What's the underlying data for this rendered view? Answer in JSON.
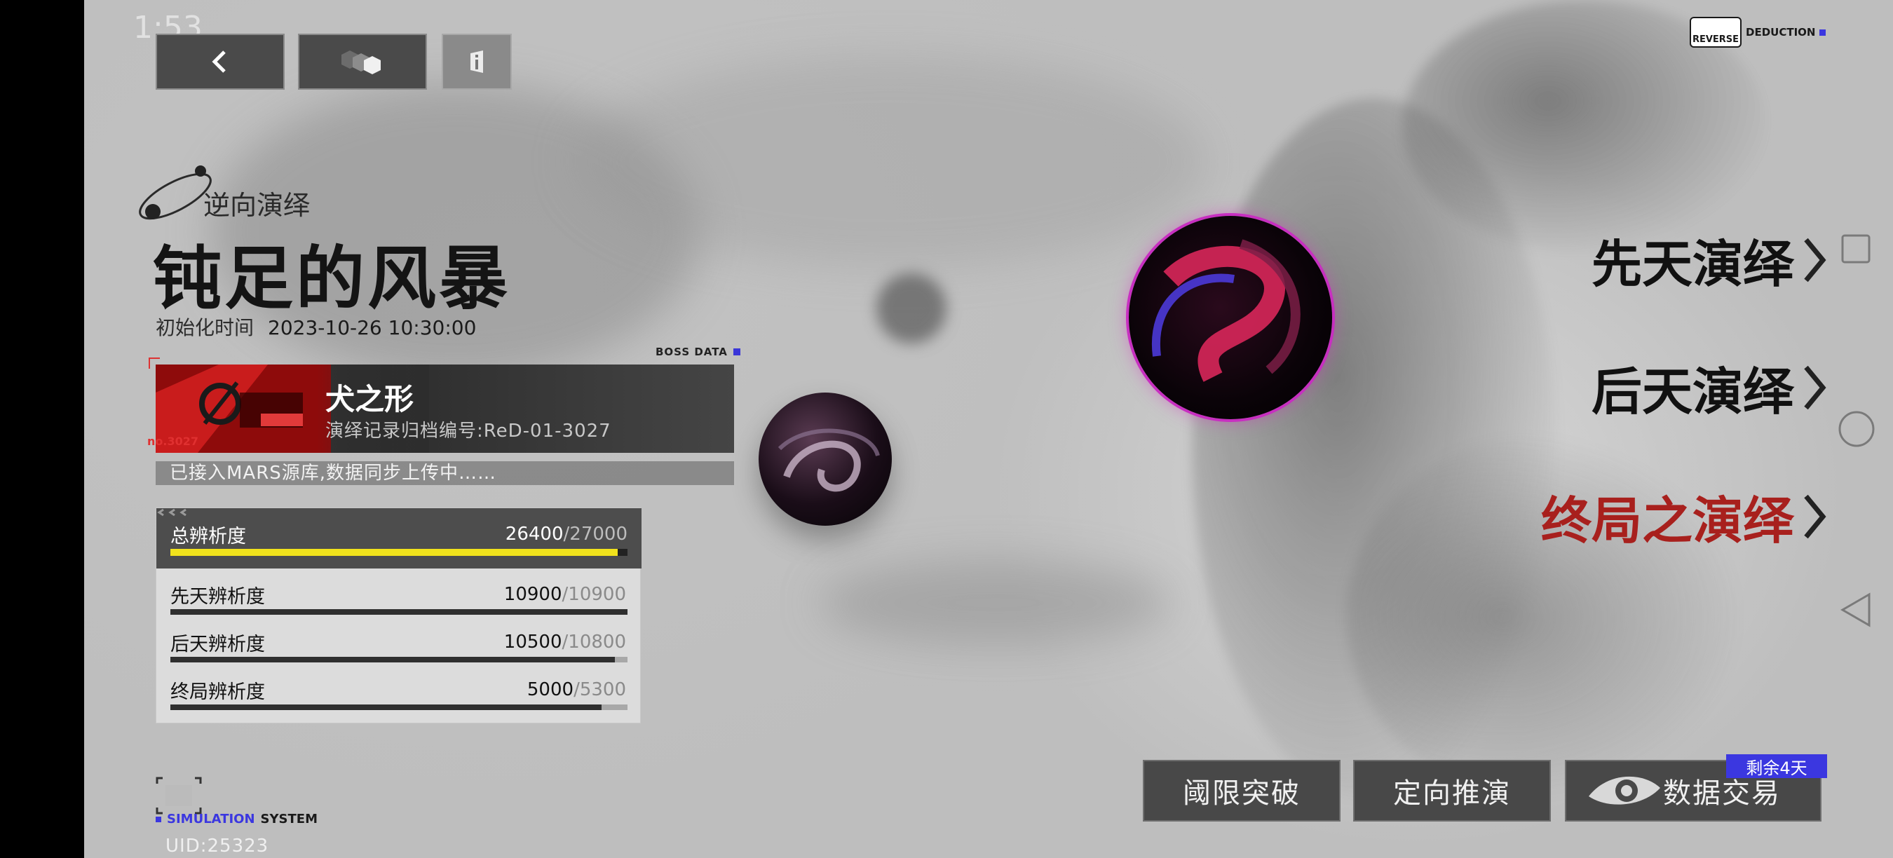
{
  "status_bar": {
    "time": "1:53"
  },
  "top_buttons": {
    "back_icon": "chevron-left-icon",
    "switch_icon": "cube-switch-icon",
    "info_icon": "info-icon"
  },
  "brand": {
    "reverse": "REVERSE",
    "deduction": "DEDUCTION"
  },
  "stage": {
    "eyebrow": "逆向演绎",
    "title": "钝足的风暴",
    "init_label": "初始化时间",
    "init_value": "2023-10-26 10:30:00"
  },
  "boss": {
    "header": "BOSS DATA",
    "name": "犬之形",
    "record_code": "演绎记录归档编号:ReD-01-3027",
    "number": "no.3027",
    "sync_status": "已接入MARS源库,数据同步上传中……"
  },
  "stats": [
    {
      "label": "总辨析度",
      "current": "26400",
      "max": "/27000",
      "progress": 0.978
    },
    {
      "label": "先天辨析度",
      "current": "10900",
      "max": "/10900",
      "progress": 1.0
    },
    {
      "label": "后天辨析度",
      "current": "10500",
      "max": "/10800",
      "progress": 0.972
    },
    {
      "label": "终局辨析度",
      "current": "5000",
      "max": "/5300",
      "progress": 0.943
    }
  ],
  "modes": [
    {
      "label": "先天演绎",
      "color": "#111111"
    },
    {
      "label": "后天演绎",
      "color": "#111111"
    },
    {
      "label": "终局之演绎",
      "color": "#a8201d"
    }
  ],
  "bottom_buttons": {
    "threshold": "阈限突破",
    "directed": "定向推演",
    "trade": "数据交易",
    "trade_badge": "剩余4天"
  },
  "footer": {
    "simulation": "SIMULATION",
    "system": "SYSTEM",
    "uid": "UID:25323"
  },
  "colors": {
    "accent_blue": "#3b37e0",
    "highlight_red": "#a8201d",
    "progress_yellow": "#f1e21c"
  }
}
